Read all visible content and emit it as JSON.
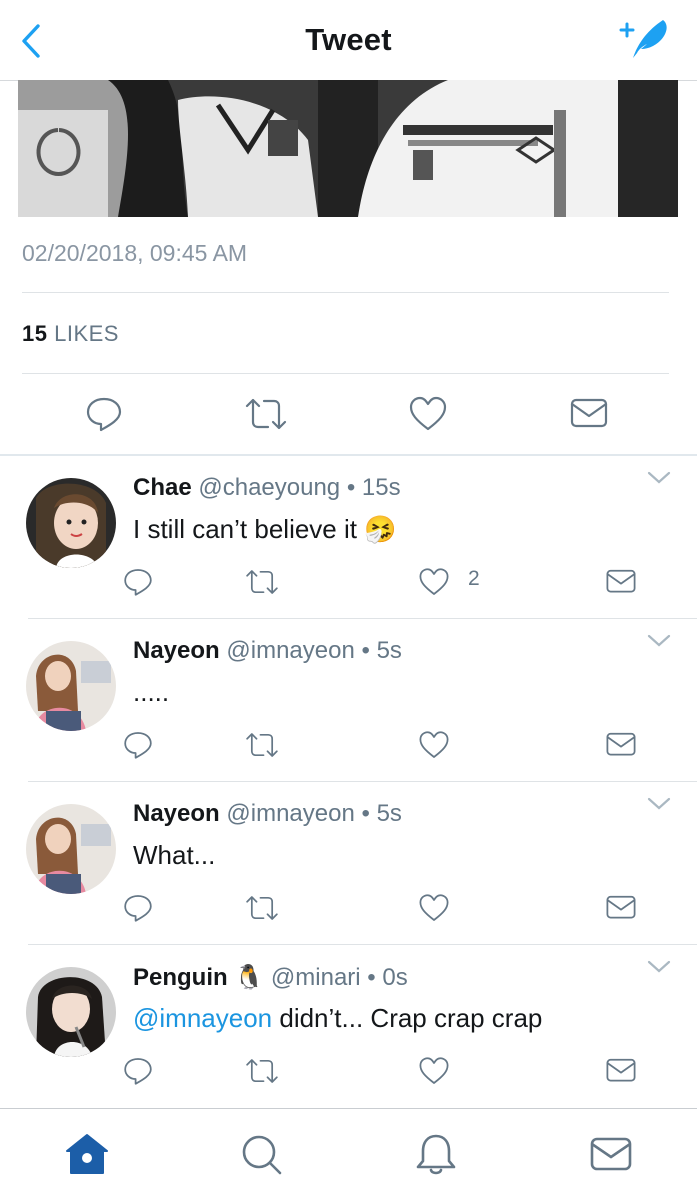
{
  "header": {
    "title": "Tweet"
  },
  "tweet": {
    "timestamp": "02/20/2018, 09:45 AM",
    "likes_count": "15",
    "likes_label": "LIKES"
  },
  "replies": [
    {
      "name": "Chae",
      "handle": "@chaeyoung",
      "dot": "•",
      "time": "15s",
      "text": "I still can’t believe it",
      "emoji": "🤧",
      "like_count": "2"
    },
    {
      "name": "Nayeon",
      "handle": "@imnayeon",
      "dot": "•",
      "time": "5s",
      "text": "....."
    },
    {
      "name": "Nayeon",
      "handle": "@imnayeon",
      "dot": "•",
      "time": "5s",
      "text": "What..."
    },
    {
      "name": "Penguin",
      "name_emoji": "🐧",
      "handle": "@minari",
      "dot": "•",
      "time": "0s",
      "mention": "@imnayeon",
      "text": " didn’t... Crap crap crap"
    }
  ],
  "colors": {
    "accent": "#1da1f2",
    "icon": "#657786",
    "tab_active": "#1c5ea8"
  },
  "icons": [
    "back-chevron",
    "compose-quill",
    "reply",
    "retweet",
    "like-heart",
    "direct-message",
    "chevron-down",
    "home",
    "search",
    "notifications",
    "messages"
  ]
}
